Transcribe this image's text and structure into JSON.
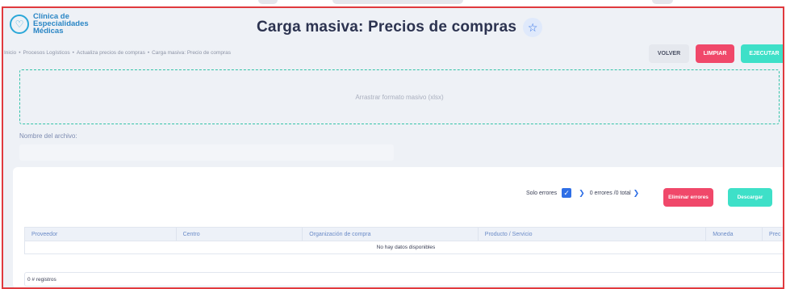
{
  "brand": {
    "logo_line1": "Clínica de",
    "logo_line2": "Especialidades",
    "logo_line3": "Médicas",
    "logo_icon": "stethoscope-heart-icon"
  },
  "header": {
    "title": "Carga masiva: Precios de compras",
    "favorite_icon": "star-outline-icon"
  },
  "breadcrumb": [
    "Inicio",
    "Procesos Logísticos",
    "Actualiza precios de compras",
    "Carga masiva: Precio de compras"
  ],
  "actions": {
    "volver": "VOLVER",
    "limpiar": "LIMPIAR",
    "ejecutar": "EJECUTAR"
  },
  "upload": {
    "dropzone_text": "Arrastrar formato masivo (xlsx)",
    "file_label": "Nombre del archivo:",
    "file_value": ""
  },
  "results": {
    "solo_errores_label": "Solo errores",
    "solo_errores_checked": true,
    "errors_summary": "0 errores /0 total",
    "eliminar_errores": "Eliminar errores",
    "descargar": "Descargar",
    "columns": [
      "Proveedor",
      "Centro",
      "Organización de compra",
      "Producto / Servicio",
      "Moneda",
      "Prec"
    ],
    "empty_text": "No hay datos disponibles",
    "records_text": "0 # registros"
  },
  "colors": {
    "accent_blue": "#2f6fe6",
    "danger": "#f0486a",
    "success": "#3ee0c8",
    "frame_border": "#e0393e"
  }
}
